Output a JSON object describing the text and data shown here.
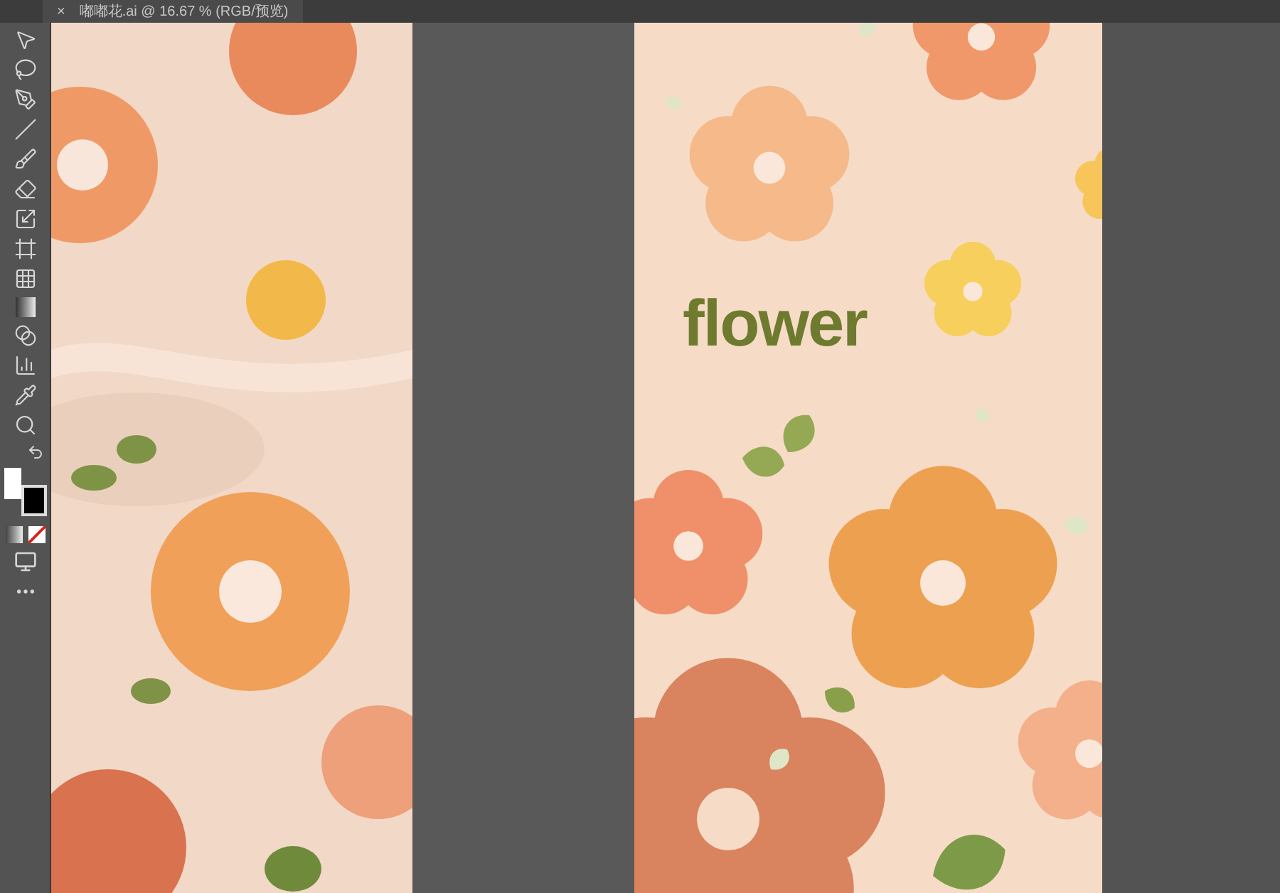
{
  "document_tab": {
    "close": "×",
    "title": "嘟嘟花.ai @ 16.67 % (RGB/预览)"
  },
  "right_artboard": {
    "headline": "flower"
  }
}
